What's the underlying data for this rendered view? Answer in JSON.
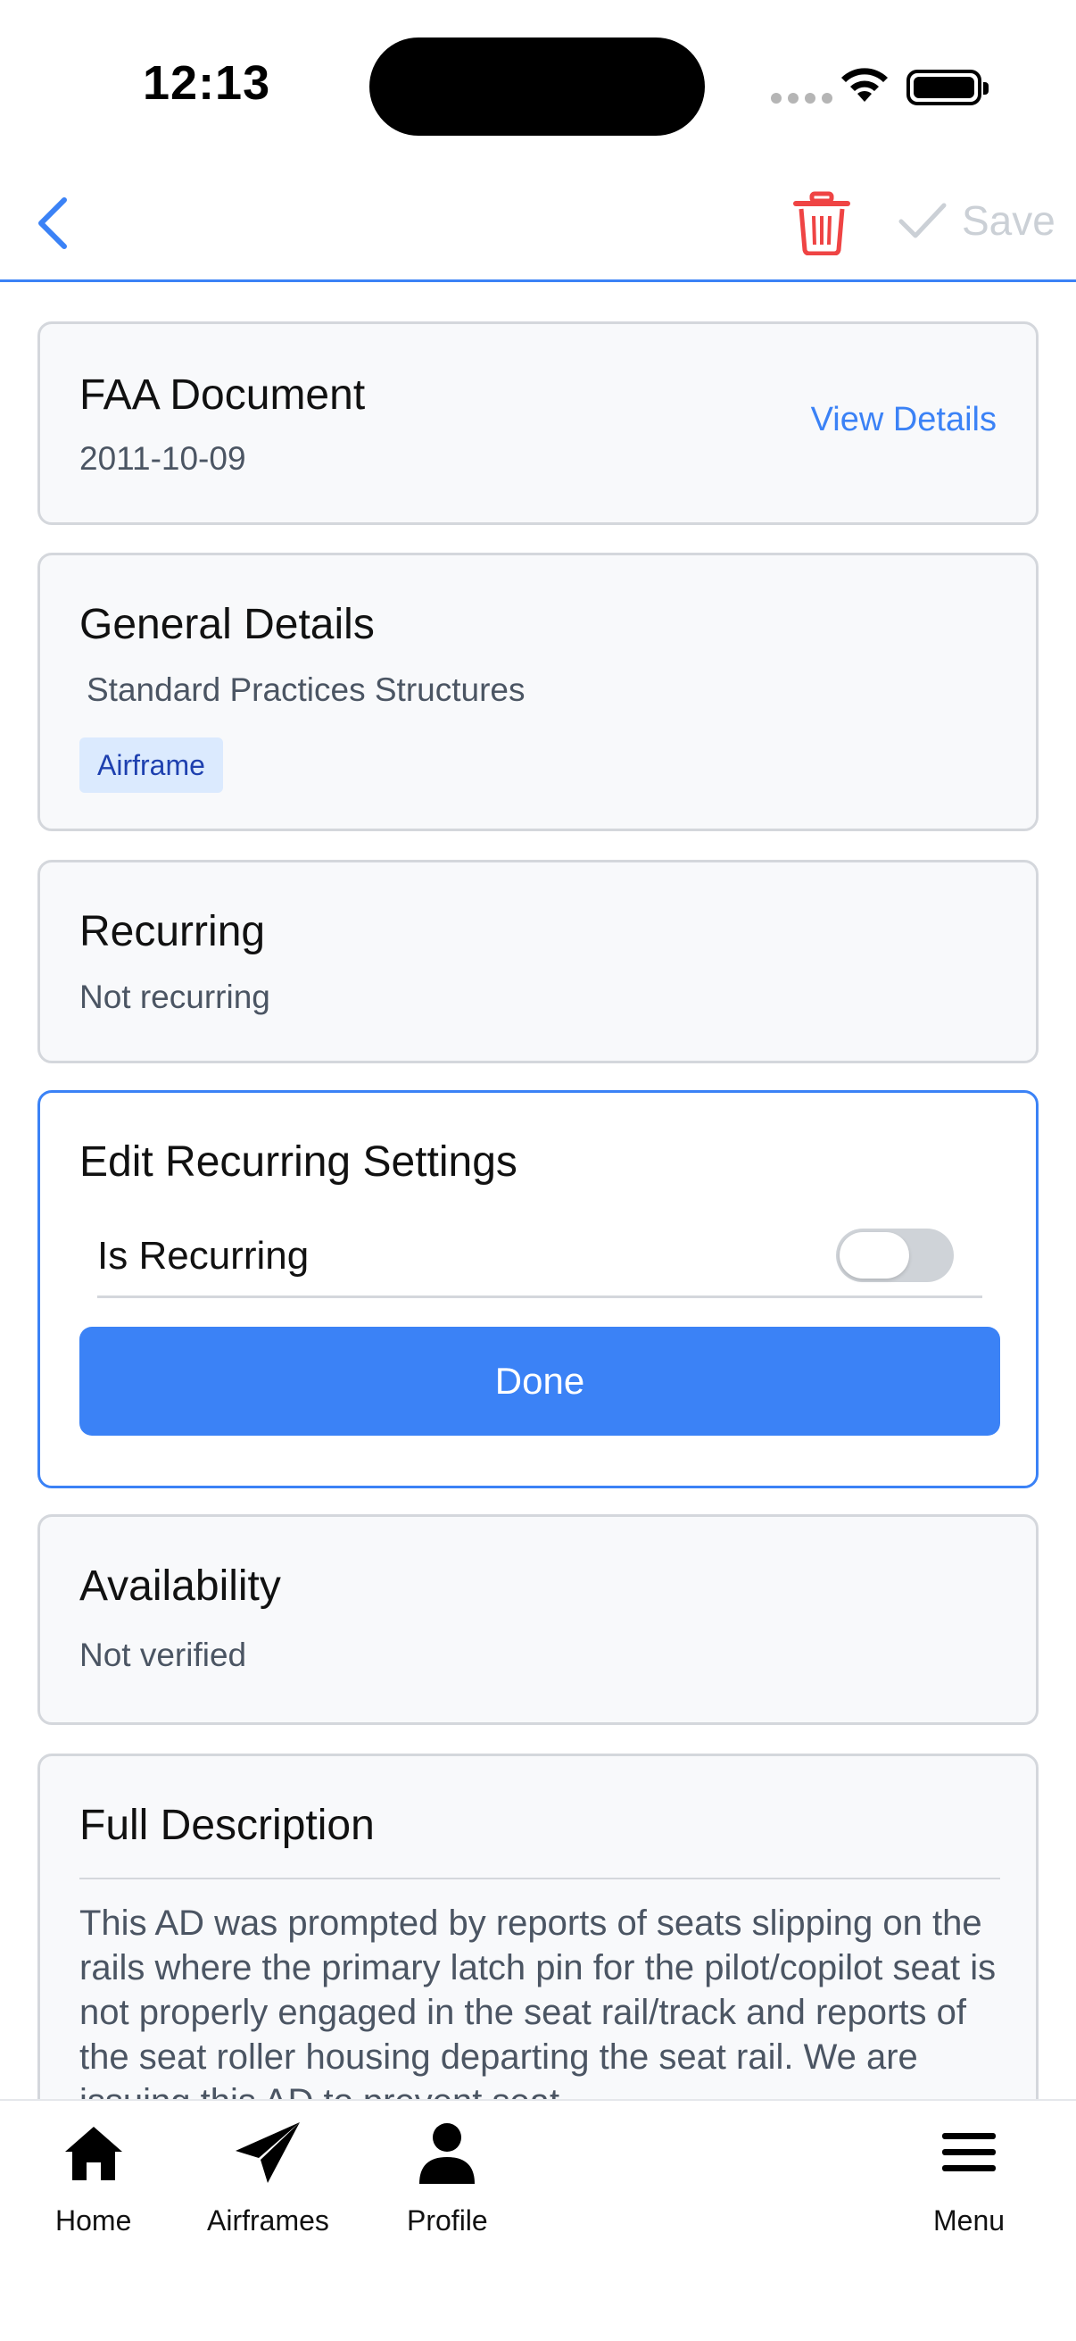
{
  "status_bar": {
    "time": "12:13"
  },
  "nav": {
    "back_icon": "chevron-left-icon",
    "delete_icon": "trash-icon",
    "save_label": "Save",
    "colors": {
      "accent": "#3b82f6",
      "delete": "#ef4444",
      "disabled": "#cbd0d6"
    }
  },
  "faa_document": {
    "title": "FAA Document",
    "date": "2011-10-09",
    "view_details_label": "View Details"
  },
  "general_details": {
    "title": "General Details",
    "subtitle": "Standard Practices Structures",
    "tag": "Airframe"
  },
  "recurring": {
    "title": "Recurring",
    "value": "Not recurring"
  },
  "edit_recurring": {
    "title": "Edit Recurring Settings",
    "toggle_label": "Is Recurring",
    "toggle_on": false,
    "done_label": "Done"
  },
  "availability": {
    "title": "Availability",
    "value": "Not verified"
  },
  "full_description": {
    "title": "Full Description",
    "text": "This AD was prompted by reports of seats slipping on the rails where the primary latch pin for the pilot/copilot seat is not properly engaged in the seat rail/track and reports of the seat roller housing departing the seat rail. We are issuing this AD to prevent seat"
  },
  "tab_bar": {
    "items": [
      {
        "label": "Home",
        "icon": "home-icon"
      },
      {
        "label": "Airframes",
        "icon": "paper-plane-icon"
      },
      {
        "label": "Profile",
        "icon": "user-icon"
      },
      {
        "label": "Menu",
        "icon": "menu-icon"
      }
    ]
  }
}
